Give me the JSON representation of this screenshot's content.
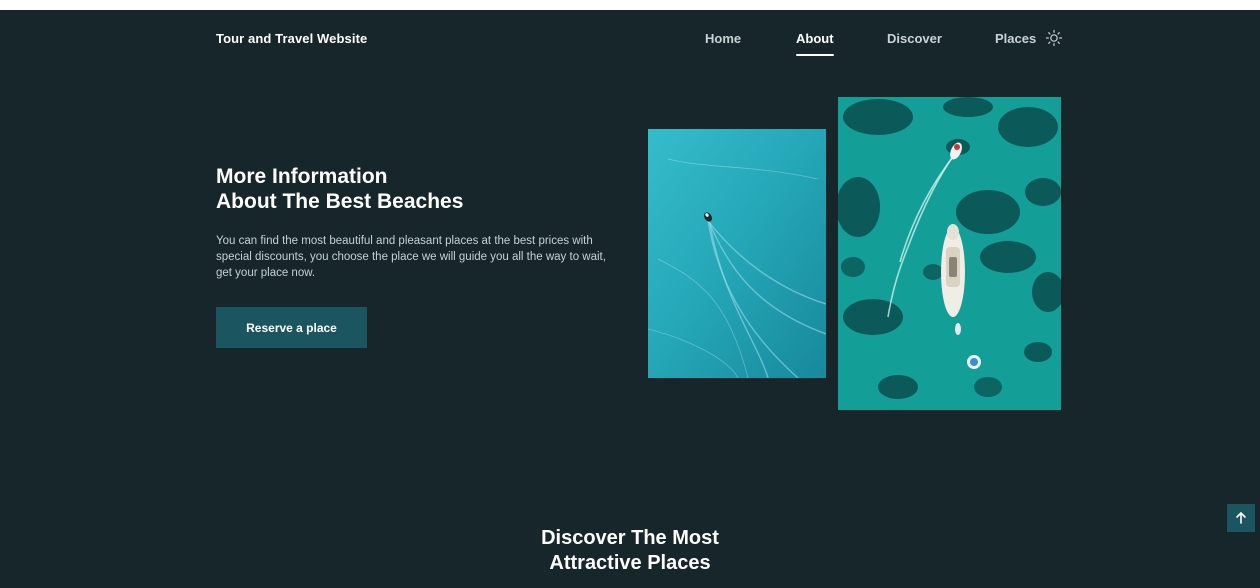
{
  "header": {
    "logo": "Tour and Travel Website",
    "nav": [
      {
        "label": "Home",
        "active": false
      },
      {
        "label": "About",
        "active": true
      },
      {
        "label": "Discover",
        "active": false
      },
      {
        "label": "Places",
        "active": false
      }
    ],
    "theme_icon": "sun-icon"
  },
  "hero": {
    "title_line1": "More Information",
    "title_line2": "About The Best Beaches",
    "description": "You can find the most beautiful and pleasant places at the best prices with special discounts, you choose the place we will guide you all the way to wait, get your place now.",
    "button_label": "Reserve a place"
  },
  "images": [
    {
      "subject": "aerial view of a small boat leaving a wake on turquoise water"
    },
    {
      "subject": "aerial view of a yacht and boats over turquoise water with dark reefs"
    }
  ],
  "discover": {
    "title_line1": "Discover The Most",
    "title_line2": "Attractive Places"
  },
  "scroll_up_icon": "arrow-up-icon",
  "colors": {
    "background": "#17262a",
    "accent": "#1b5560",
    "text": "#ffffff"
  }
}
